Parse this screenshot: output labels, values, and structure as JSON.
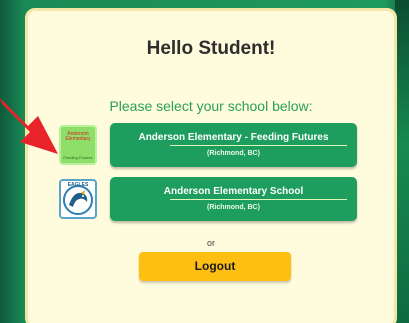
{
  "header": {
    "greeting": "Hello Student!",
    "instruction": "Please select your school below:"
  },
  "schools": [
    {
      "name": "Anderson Elementary - Feeding Futures",
      "location": "(Richmond, BC)",
      "logo_text": "Anderson Elementary",
      "logo_subtext": "Feeding Futures",
      "logo_icon": "feeding-futures-logo"
    },
    {
      "name": "Anderson Elementary School",
      "location": "(Richmond, BC)",
      "logo_text": "EAGLES",
      "logo_icon": "eagles-logo"
    }
  ],
  "separator_text": "or",
  "logout_label": "Logout",
  "colors": {
    "background_green": "#1f9a5e",
    "card_background": "#fffbdd",
    "button_green": "#1e9e5e",
    "subtitle_green": "#2aa05a",
    "logout_yellow": "#fdbf12",
    "annotation_arrow": "#e8232a"
  }
}
